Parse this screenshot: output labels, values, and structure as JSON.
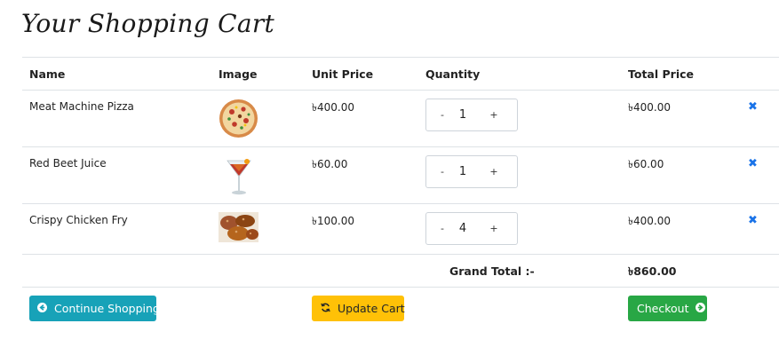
{
  "page": {
    "title": "Your Shopping Cart"
  },
  "table": {
    "headers": {
      "name": "Name",
      "image": "Image",
      "unit_price": "Unit Price",
      "quantity": "Quantity",
      "total_price": "Total Price"
    },
    "rows": [
      {
        "name": "Meat Machine Pizza",
        "image": "pizza",
        "unit_price": "৳400.00",
        "quantity": "1",
        "total": "৳400.00",
        "minus": "-",
        "plus": "+",
        "remove": "✖"
      },
      {
        "name": "Red Beet Juice",
        "image": "cocktail-glass",
        "unit_price": "৳60.00",
        "quantity": "1",
        "total": "৳60.00",
        "minus": "-",
        "plus": "+",
        "remove": "✖"
      },
      {
        "name": "Crispy Chicken Fry",
        "image": "fried-chicken",
        "unit_price": "৳100.00",
        "quantity": "4",
        "total": "৳400.00",
        "minus": "-",
        "plus": "+",
        "remove": "✖"
      }
    ],
    "grand_total_label": "Grand Total :-",
    "grand_total_value": "৳860.00"
  },
  "actions": {
    "continue_label": "Continue Shopping",
    "update_label": "Update Cart",
    "checkout_label": "Checkout"
  },
  "colors": {
    "continue": "#17a2b8",
    "update": "#ffc107",
    "checkout": "#28a745",
    "remove_icon": "#1a73e8"
  }
}
